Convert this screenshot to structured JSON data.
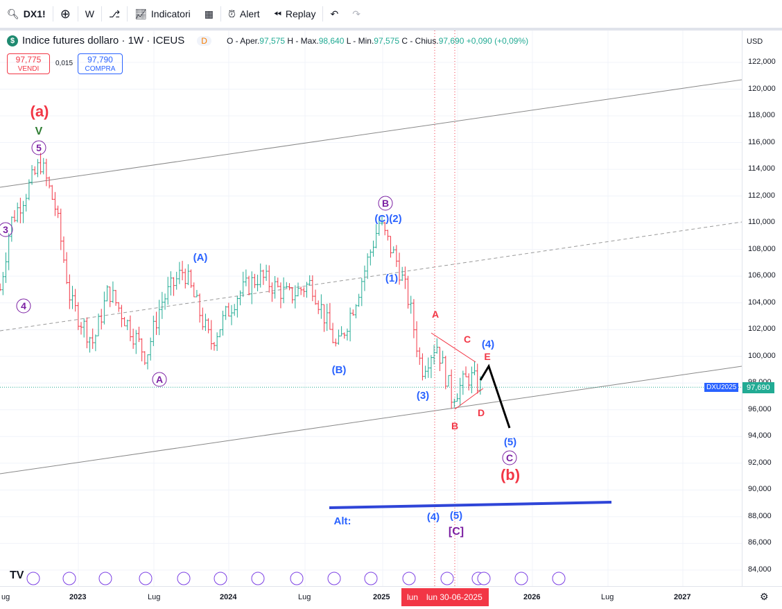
{
  "toolbar": {
    "symbol": "DX1!",
    "interval": "W",
    "indicators": "Indicatori",
    "alert": "Alert",
    "replay": "Replay"
  },
  "legend": {
    "title": "Indice futures dollaro · 1W · ICEUS",
    "badge": "D",
    "o_label": "O - Aper.",
    "o": "97,575",
    "h_label": "H - Max.",
    "h": "98,640",
    "l_label": "L - Min.",
    "l": "97,575",
    "c_label": "C - Chius.",
    "c": "97,690",
    "change": "+0,090 (+0,09%)"
  },
  "trade": {
    "sell_price": "97,775",
    "sell_label": "VENDI",
    "spread": "0,015",
    "buy_price": "97,790",
    "buy_label": "COMPRA"
  },
  "y_axis": {
    "currency": "USD",
    "ticks": [
      "122,000",
      "120,000",
      "118,000",
      "116,000",
      "114,000",
      "112,000",
      "110,000",
      "108,000",
      "106,000",
      "104,000",
      "102,000",
      "100,000",
      "98,000",
      "96,000",
      "94,000",
      "92,000",
      "90,000",
      "88,000",
      "86,000",
      "84,000"
    ],
    "symbol_tag": "DXU2025",
    "last_price": "97,690"
  },
  "x_axis": {
    "ticks": [
      "ug",
      "2023",
      "Lug",
      "2024",
      "Lug",
      "2025",
      "2026",
      "Lug",
      "2027"
    ],
    "cursor_label": "lun",
    "cursor_date": "lun 30-06-2025"
  },
  "colors": {
    "up": "#22ab94",
    "down": "#f23645",
    "wave_blue": "#2962ff",
    "wave_purple": "#7b1fa2",
    "wave_red": "#f23645"
  },
  "annotations": [
    "(a)",
    "V",
    "5",
    "3",
    "4",
    "A",
    "(A)",
    "(B)",
    "B",
    "(C)(2)",
    "(1)",
    "(3)",
    "A",
    "C",
    "(4)",
    "E",
    "D",
    "B",
    "(5)",
    "C",
    "(b)",
    "Alt:",
    "(4)",
    "(5)",
    "[C]"
  ],
  "chart_data": {
    "type": "candlestick",
    "interval": "1W",
    "waypoints": [
      [
        2022.48,
        105
      ],
      [
        2022.55,
        110
      ],
      [
        2022.75,
        114.5
      ],
      [
        2022.85,
        111
      ],
      [
        2022.95,
        104
      ],
      [
        2023.1,
        101
      ],
      [
        2023.2,
        105
      ],
      [
        2023.45,
        100
      ],
      [
        2023.55,
        104
      ],
      [
        2023.7,
        106.5
      ],
      [
        2023.88,
        101
      ],
      [
        2024.05,
        104.5
      ],
      [
        2024.2,
        106
      ],
      [
        2024.4,
        104.5
      ],
      [
        2024.55,
        105.5
      ],
      [
        2024.72,
        100.5
      ],
      [
        2024.85,
        104.5
      ],
      [
        2025.0,
        110
      ],
      [
        2025.12,
        107
      ],
      [
        2025.2,
        104
      ],
      [
        2025.28,
        99
      ],
      [
        2025.38,
        101
      ],
      [
        2025.48,
        97
      ],
      [
        2025.6,
        98.5
      ],
      [
        2025.68,
        97.69
      ]
    ],
    "ylim": [
      84,
      122
    ]
  }
}
